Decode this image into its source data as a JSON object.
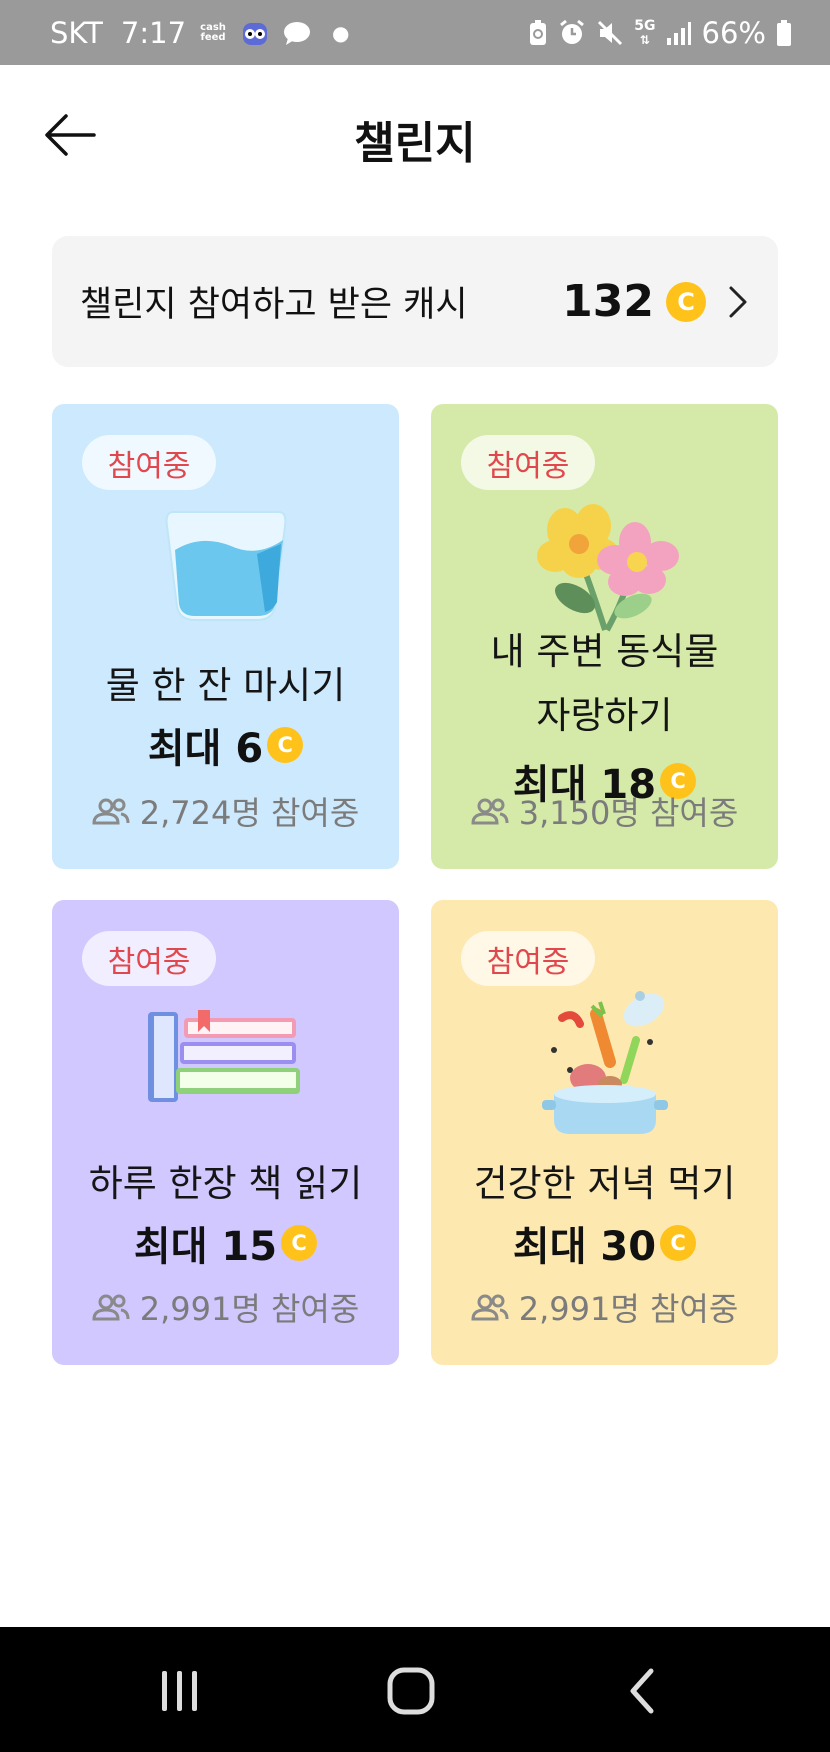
{
  "status_bar": {
    "carrier": "SKT",
    "time": "7:17",
    "app_logo_text": "cash feed",
    "network": "5G",
    "battery": "66%"
  },
  "header": {
    "title": "챌린지",
    "back_icon": "arrow-left-icon"
  },
  "cash_summary": {
    "label": "챌린지 참여하고 받은 캐시",
    "amount": "132",
    "coin_symbol": "C"
  },
  "challenges": [
    {
      "badge": "참여중",
      "title_lines": [
        "물 한 잔 마시기"
      ],
      "reward": "최대 6",
      "coin_symbol": "C",
      "participants": "2,724명 참여중",
      "bg": "#cce9fd",
      "illustration": "water-glass"
    },
    {
      "badge": "참여중",
      "title_lines": [
        "내 주변 동식물",
        "자랑하기"
      ],
      "reward": "최대 18",
      "coin_symbol": "C",
      "participants": "3,150명 참여중",
      "bg": "#d5eaa8",
      "illustration": "flowers"
    },
    {
      "badge": "참여중",
      "title_lines": [
        "하루 한장 책 읽기"
      ],
      "reward": "최대 15",
      "coin_symbol": "C",
      "participants": "2,991명 참여중",
      "bg": "#d0c8fe",
      "illustration": "books"
    },
    {
      "badge": "참여중",
      "title_lines": [
        "건강한 저녁 먹기"
      ],
      "reward": "최대 30",
      "coin_symbol": "C",
      "participants": "2,991명 참여중",
      "bg": "#fde8b0",
      "illustration": "cooking-pot"
    }
  ],
  "colors": {
    "coin": "#ffc21a",
    "badge_text": "#e0484d",
    "muted_text": "#7b7b7b"
  }
}
